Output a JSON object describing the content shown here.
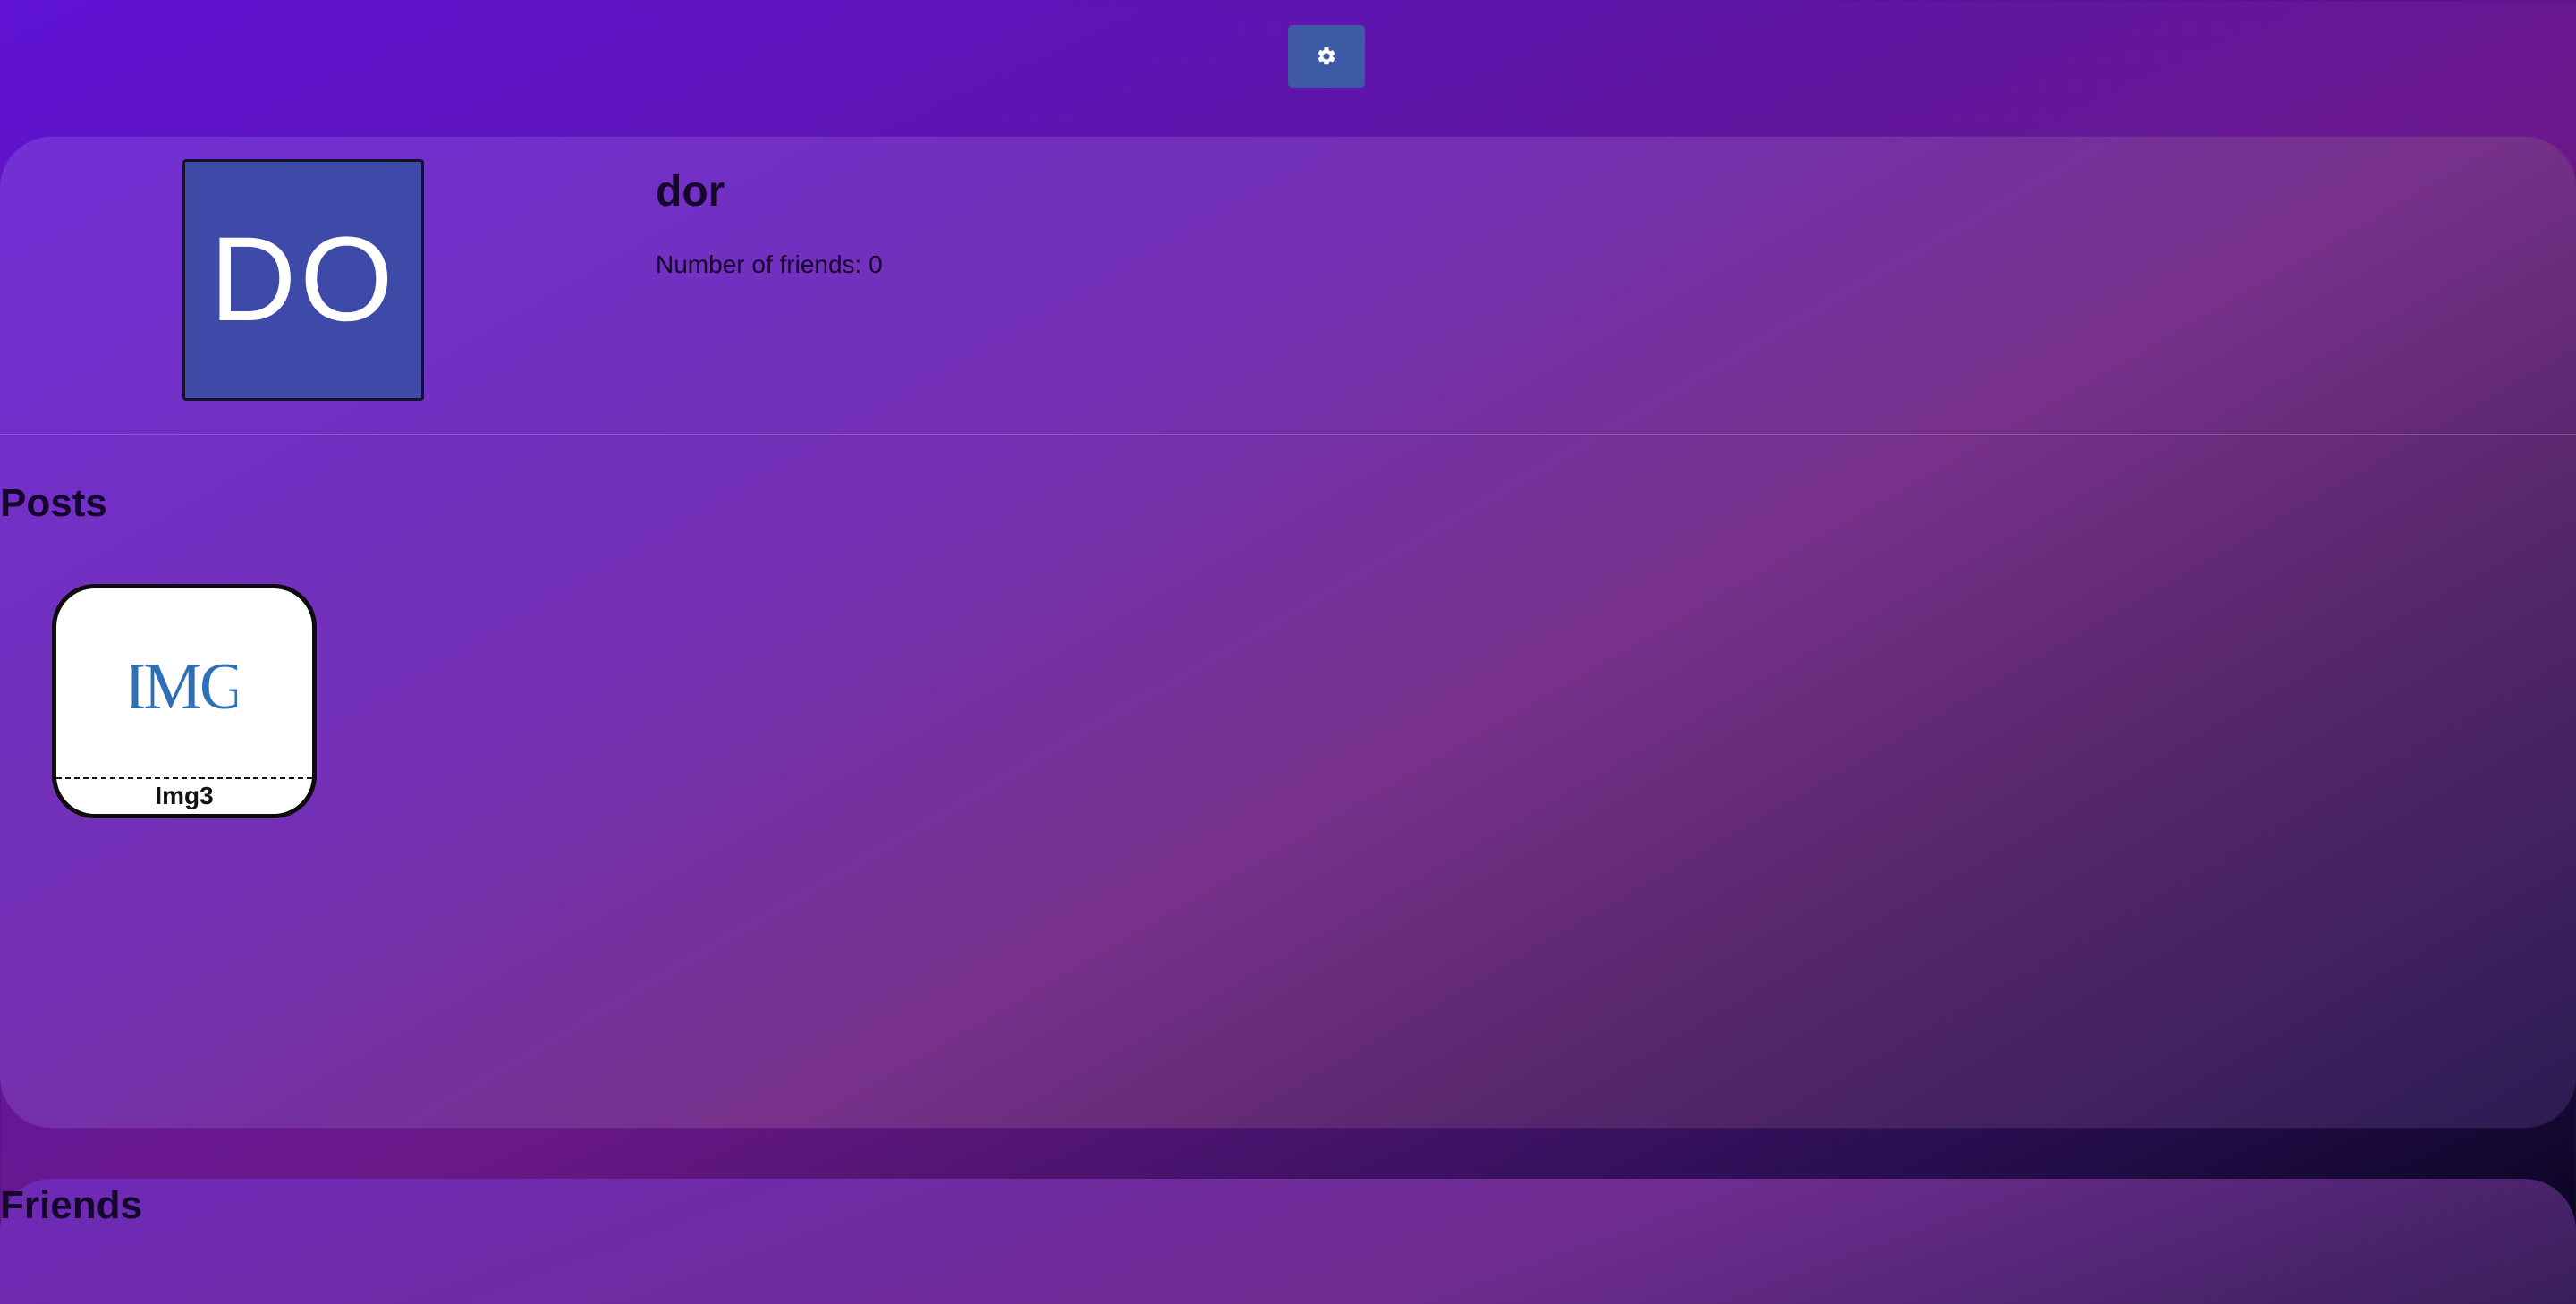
{
  "header": {
    "settings_icon": "gear-icon"
  },
  "profile": {
    "avatar_initials": "DO",
    "name": "dor",
    "friends_text": "Number of friends: 0"
  },
  "posts": {
    "heading": "Posts",
    "items": [
      {
        "image_icon": "img-logo-icon",
        "image_text": "IMG",
        "caption": "Img3"
      }
    ]
  },
  "friends": {
    "heading": "Friends"
  },
  "colors": {
    "settings_button": "#3f5aa4",
    "avatar_background": "#3d4aa8",
    "img_logo": "#2f6fb6",
    "text_dark": "#15062e"
  }
}
